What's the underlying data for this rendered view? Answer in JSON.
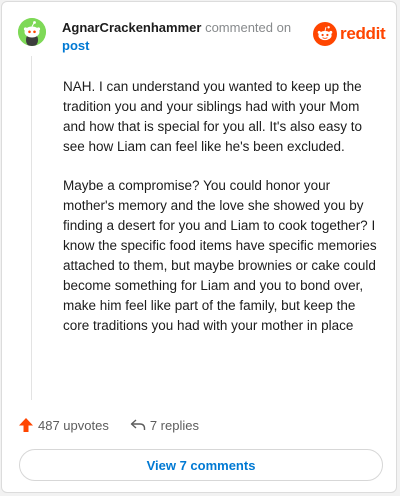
{
  "comment": {
    "username": "AgnarCrackenhammer",
    "action_text": "commented on",
    "post_link": "post",
    "paragraphs": [
      "NAH. I can understand you wanted to keep up the tradition you and your siblings had with your Mom and how that is special for you all. It's also easy to see how Liam can feel like he's been excluded.",
      "Maybe a compromise? You could honor your mother's memory and the love she showed you by finding a desert for you and Liam to cook together? I know the specific food items have specific memories attached to them, but maybe brownies or cake could become something for Liam and you to bond over, make him feel like part of the family, but keep the core traditions you had with your mother in place"
    ],
    "upvotes_label": "487 upvotes",
    "replies_label": "7 replies",
    "view_comments_label": "View 7 comments"
  },
  "brand": {
    "logo_text": "reddit",
    "accent_color": "#ff4500"
  },
  "icons": {
    "avatar": "snoo-avatar-icon",
    "logo": "reddit-logo-icon",
    "upvote": "upvote-arrow-icon",
    "reply": "reply-arrow-icon"
  },
  "colors": {
    "link": "#0079d3",
    "avatar_bg": "#7ed957"
  }
}
